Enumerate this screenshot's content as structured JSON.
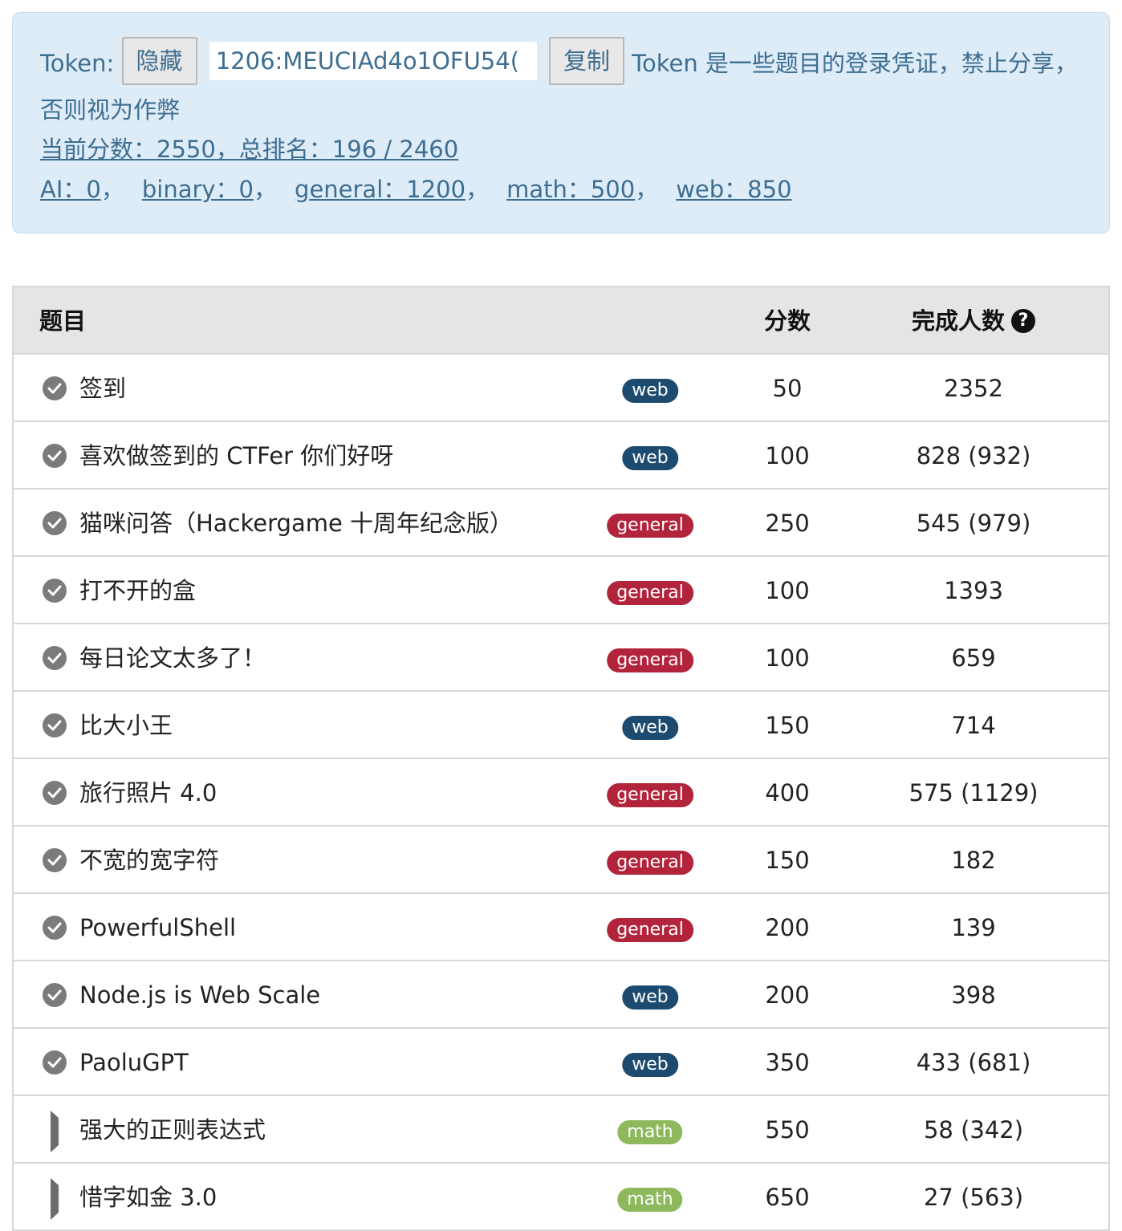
{
  "header": {
    "token_label": "Token:",
    "hide_button": "隐藏",
    "token_value": "1206:MEUCIAd4o1OFU54(",
    "copy_button": "复制",
    "token_note": "Token 是一些题目的登录凭证，禁止分享，否则视为作弊",
    "score_text": "当前分数：2550，总排名：196 / 2460",
    "categories": [
      {
        "text": "AI：0"
      },
      {
        "text": "binary：0"
      },
      {
        "text": "general：1200"
      },
      {
        "text": "math：500"
      },
      {
        "text": "web：850"
      }
    ],
    "category_separator": "，"
  },
  "table": {
    "headers": {
      "title": "题目",
      "score": "分数",
      "solved": "完成人数",
      "help_icon": "question-circle-icon"
    },
    "tag_colors": {
      "web": "#1d4b6f",
      "general": "#b2233c",
      "math": "#8db85b"
    },
    "rows": [
      {
        "status": "solved",
        "title": "签到",
        "tag": "web",
        "score": "50",
        "solved": "2352"
      },
      {
        "status": "solved",
        "title": "喜欢做签到的 CTFer 你们好呀",
        "tag": "web",
        "score": "100",
        "solved": "828 (932)"
      },
      {
        "status": "solved",
        "title": "猫咪问答（Hackergame 十周年纪念版）",
        "tag": "general",
        "score": "250",
        "solved": "545 (979)"
      },
      {
        "status": "solved",
        "title": "打不开的盒",
        "tag": "general",
        "score": "100",
        "solved": "1393"
      },
      {
        "status": "solved",
        "title": "每日论文太多了！",
        "tag": "general",
        "score": "100",
        "solved": "659"
      },
      {
        "status": "solved",
        "title": "比大小王",
        "tag": "web",
        "score": "150",
        "solved": "714"
      },
      {
        "status": "solved",
        "title": "旅行照片 4.0",
        "tag": "general",
        "score": "400",
        "solved": "575 (1129)"
      },
      {
        "status": "solved",
        "title": "不宽的宽字符",
        "tag": "general",
        "score": "150",
        "solved": "182"
      },
      {
        "status": "solved",
        "title": "PowerfulShell",
        "tag": "general",
        "score": "200",
        "solved": "139"
      },
      {
        "status": "solved",
        "title": "Node.js is Web Scale",
        "tag": "web",
        "score": "200",
        "solved": "398"
      },
      {
        "status": "solved",
        "title": "PaoluGPT",
        "tag": "web",
        "score": "350",
        "solved": "433 (681)"
      },
      {
        "status": "collapsed",
        "title": "强大的正则表达式",
        "tag": "math",
        "score": "550",
        "solved": "58 (342)"
      },
      {
        "status": "collapsed",
        "title": "惜字如金 3.0",
        "tag": "math",
        "score": "650",
        "solved": "27 (563)"
      }
    ]
  }
}
